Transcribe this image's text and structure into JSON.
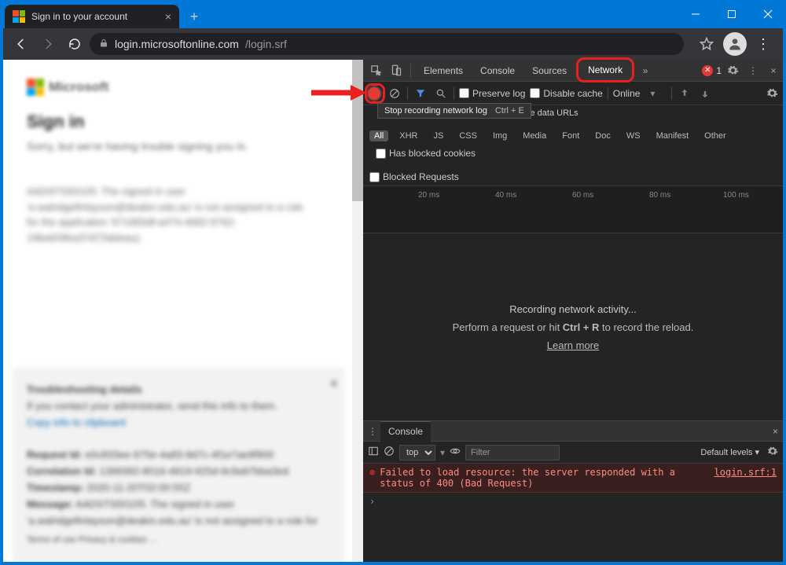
{
  "window": {
    "tab_title": "Sign in to your account"
  },
  "address_bar": {
    "host": "login.microsoftonline.com",
    "path": "/login.srf"
  },
  "page": {
    "brand": "Microsoft",
    "heading": "Sign in",
    "sorry_line": "Sorry, but we're having trouble signing you in.",
    "error_body": "AADSTS50105: The signed in user 'a.walridgefinlayson@deakin.edu.au' is not assigned to a role for the application '671683df-a474-4682-9762-19beb59ba37d'(Tableau).",
    "troubleshoot": {
      "heading": "Troubleshooting details",
      "line1": "If you contact your administrator, send this info to them.",
      "copy_link": "Copy info to clipboard",
      "req_lbl": "Request Id:",
      "req_val": "e0c833ee-975e-4a83-9d7c-4f1e7ae9f900",
      "corr_lbl": "Correlation Id:",
      "corr_val": "1399392-8016-4819-925d-9c9a97bba3ed",
      "ts_lbl": "Timestamp:",
      "ts_val": "2020-11-20T02:00:55Z",
      "msg_lbl": "Message:",
      "msg_val": "AADSTS50105: The signed in user 'a.walridgefinlayson@deakin.edu.au' is not assigned to a role for",
      "footer": "Terms of use    Privacy & cookies   ..."
    }
  },
  "devtools": {
    "tabs": [
      "Elements",
      "Console",
      "Sources",
      "Network"
    ],
    "error_count": "1",
    "toolbar": {
      "preserve_log": "Preserve log",
      "disable_cache": "Disable cache",
      "online": "Online"
    },
    "tooltip": {
      "label": "Stop recording network log",
      "kbd": "Ctrl + E"
    },
    "row2_hide": "Hide data URLs",
    "filter_pills": [
      "All",
      "XHR",
      "JS",
      "CSS",
      "Img",
      "Media",
      "Font",
      "Doc",
      "WS",
      "Manifest",
      "Other"
    ],
    "has_blocked": "Has blocked cookies",
    "blocked_req": "Blocked Requests",
    "timeline_ticks": [
      "20 ms",
      "40 ms",
      "60 ms",
      "80 ms",
      "100 ms"
    ],
    "center": {
      "title": "Recording network activity...",
      "sub_pre": "Perform a request or hit ",
      "sub_kbd": "Ctrl + R",
      "sub_post": " to record the reload.",
      "learn": "Learn more"
    },
    "drawer": {
      "tab": "Console",
      "context": "top",
      "filter_placeholder": "Filter",
      "levels": "Default levels ▾",
      "error_msg": "Failed to load resource: the server responded with a status of 400 (Bad Request)",
      "error_src": "login.srf:1"
    }
  }
}
